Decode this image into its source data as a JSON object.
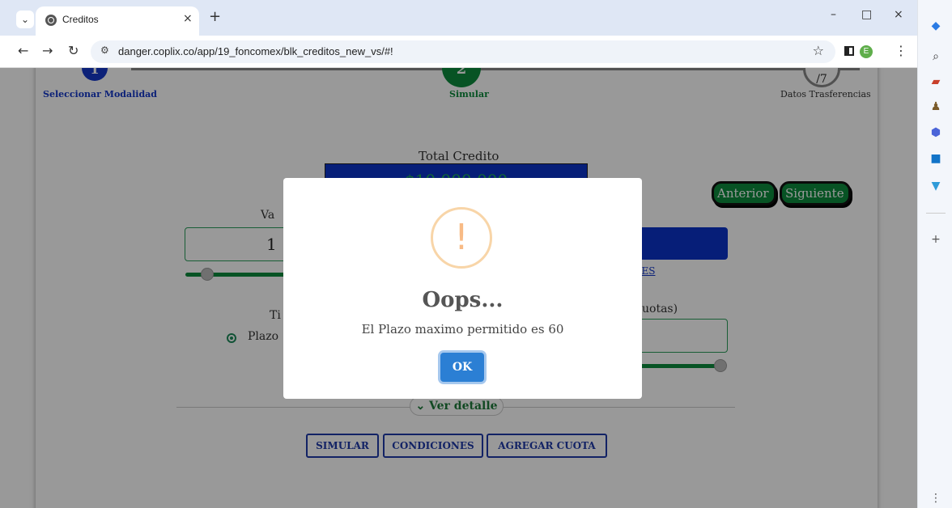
{
  "browser": {
    "tab_title": "Creditos",
    "tab_close": "×",
    "new_tab": "+",
    "url": "danger.coplix.co/app/19_foncomex/blk_creditos_new_vs/#!",
    "profile_initial": "E",
    "win_minimize": "–",
    "win_maximize": "□",
    "win_close": "×"
  },
  "stepper": {
    "step1_num": "1",
    "step1_label": "Seleccionar Modalidad",
    "step2_num": "2",
    "step2_label": "Simular",
    "step3_num": "3",
    "step3_total": "/7",
    "step3_label": "Datos Trasferencias"
  },
  "nav_buttons": {
    "anterior": "Anterior",
    "siguiente": "Siguiente"
  },
  "form": {
    "total_label": "Total Credito",
    "total_value": "$10.000.000",
    "valor_label": "Va",
    "valor_value": "1",
    "condiciones_link": "ÑES",
    "tipo_label": "Ti",
    "plazo_radio": "Plazo",
    "cuotas_label": "uotas)",
    "ver_detalle": "Ver detalle"
  },
  "actions": {
    "simular": "SIMULAR",
    "condiciones": "CONDICIONES",
    "agregar": "AGREGAR CUOTA"
  },
  "modal": {
    "icon": "!",
    "title": "Oops...",
    "message": "El Plazo maximo permitido es 60",
    "ok": "OK"
  },
  "colors": {
    "primary_green": "#0d8a3c",
    "primary_blue": "#0a33c9",
    "warning": "#f8bb86",
    "ok_button": "#2b7fd4"
  }
}
